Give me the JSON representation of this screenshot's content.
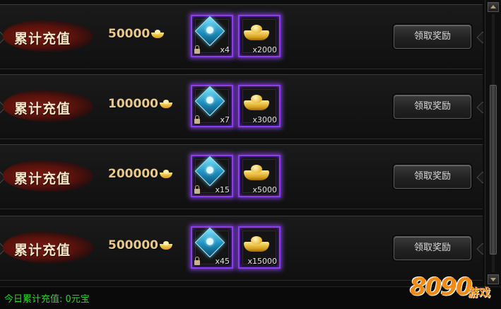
{
  "rewards": [
    {
      "label": "累计充值",
      "amount": "50000",
      "items": [
        {
          "icon": "blue-gem-icon",
          "count": "x4",
          "locked": true
        },
        {
          "icon": "gold-ingot-icon",
          "count": "x2000",
          "locked": false
        }
      ],
      "button": "领取奖励"
    },
    {
      "label": "累计充值",
      "amount": "100000",
      "items": [
        {
          "icon": "blue-gem-icon",
          "count": "x7",
          "locked": true
        },
        {
          "icon": "gold-ingot-icon",
          "count": "x3000",
          "locked": false
        }
      ],
      "button": "领取奖励"
    },
    {
      "label": "累计充值",
      "amount": "200000",
      "items": [
        {
          "icon": "blue-gem-icon",
          "count": "x15",
          "locked": true
        },
        {
          "icon": "gold-ingot-icon",
          "count": "x5000",
          "locked": false
        }
      ],
      "button": "领取奖励"
    },
    {
      "label": "累计充值",
      "amount": "500000",
      "items": [
        {
          "icon": "blue-gem-icon",
          "count": "x45",
          "locked": true
        },
        {
          "icon": "gold-ingot-icon",
          "count": "x15000",
          "locked": false
        }
      ],
      "button": "领取奖励"
    }
  ],
  "footer": {
    "today_recharge": "今日累计充值: 0元宝"
  },
  "watermark": {
    "number": "8090",
    "text": "游戏"
  },
  "colors": {
    "slot_glow": "#8b3df0",
    "banner_red": "#7a1a12",
    "amount_gold": "#e8c98a",
    "footer_green": "#2fd12f"
  }
}
